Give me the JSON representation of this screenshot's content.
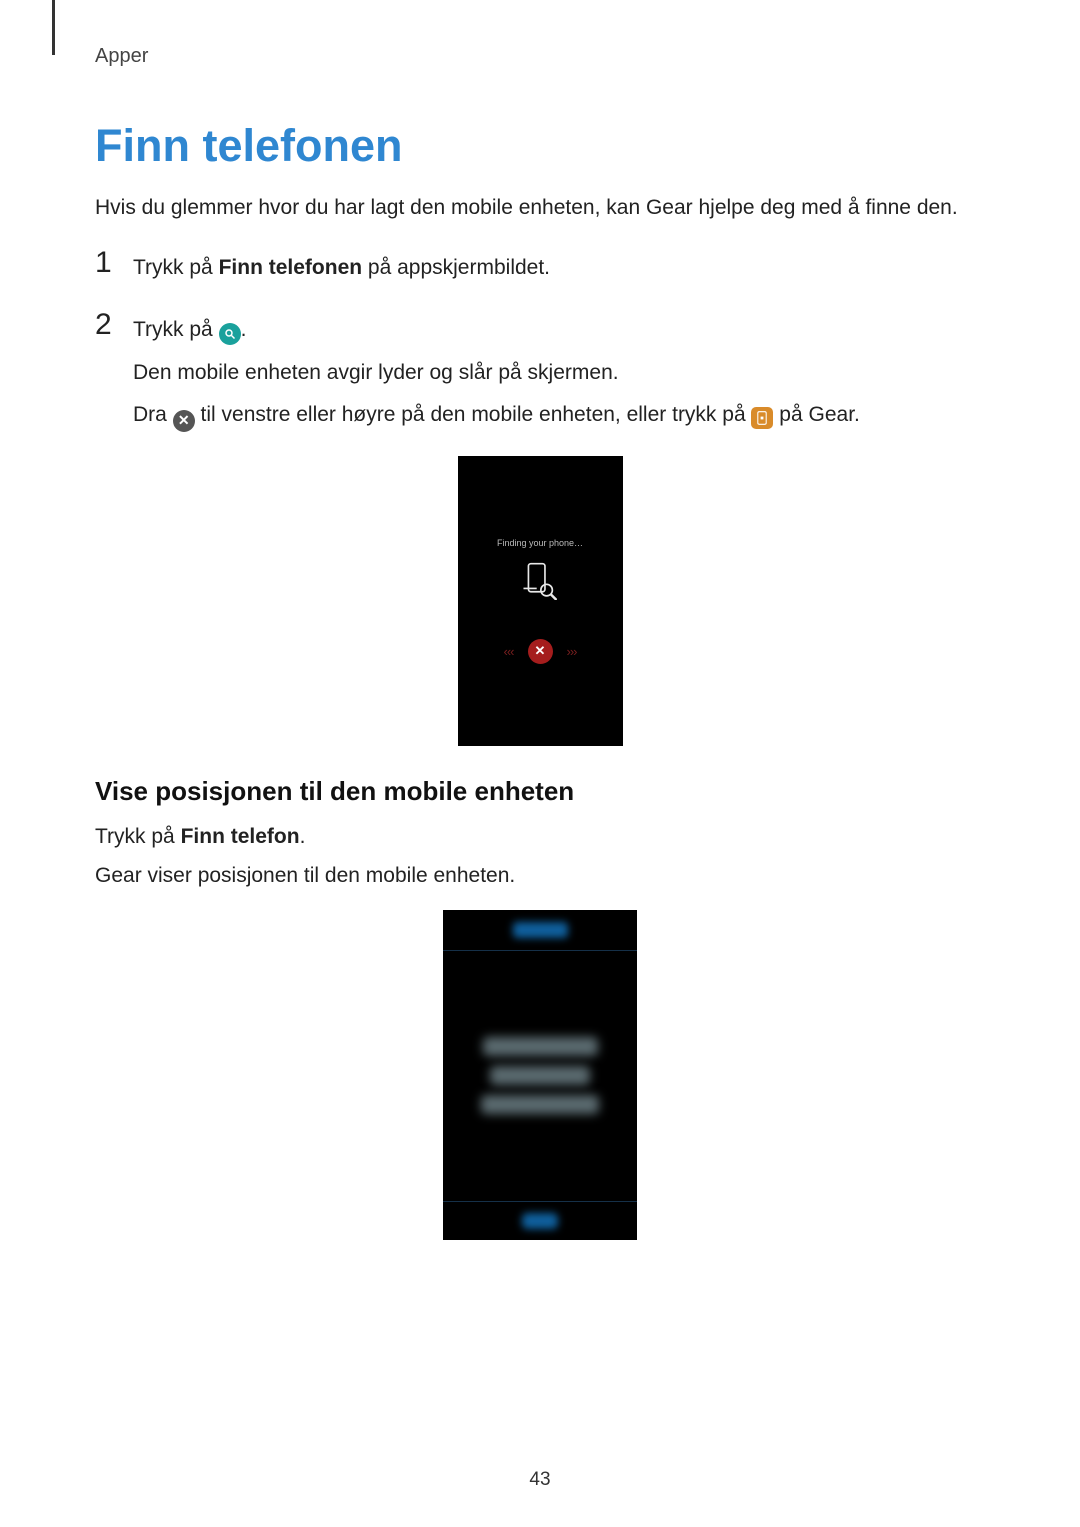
{
  "breadcrumb": "Apper",
  "title": "Finn telefonen",
  "lead": "Hvis du glemmer hvor du har lagt den mobile enheten, kan Gear hjelpe deg med å finne den.",
  "steps": {
    "one": {
      "number": "1",
      "text_before": "Trykk på ",
      "bold": "Finn telefonen",
      "text_after": " på appskjermbildet."
    },
    "two": {
      "number": "2",
      "line1_before": "Trykk på ",
      "line1_after": ".",
      "line2": "Den mobile enheten avgir lyder og slår på skjermen.",
      "line3_before": "Dra ",
      "line3_mid": " til venstre eller høyre på den mobile enheten, eller trykk på ",
      "line3_after": " på Gear."
    }
  },
  "device1": {
    "status": "Finding your phone…"
  },
  "subheading": "Vise posisjonen til den mobile enheten",
  "body": {
    "line1_before": "Trykk på ",
    "line1_bold": "Finn telefon",
    "line1_after": ".",
    "line2": "Gear viser posisjonen til den mobile enheten."
  },
  "page_number": "43"
}
